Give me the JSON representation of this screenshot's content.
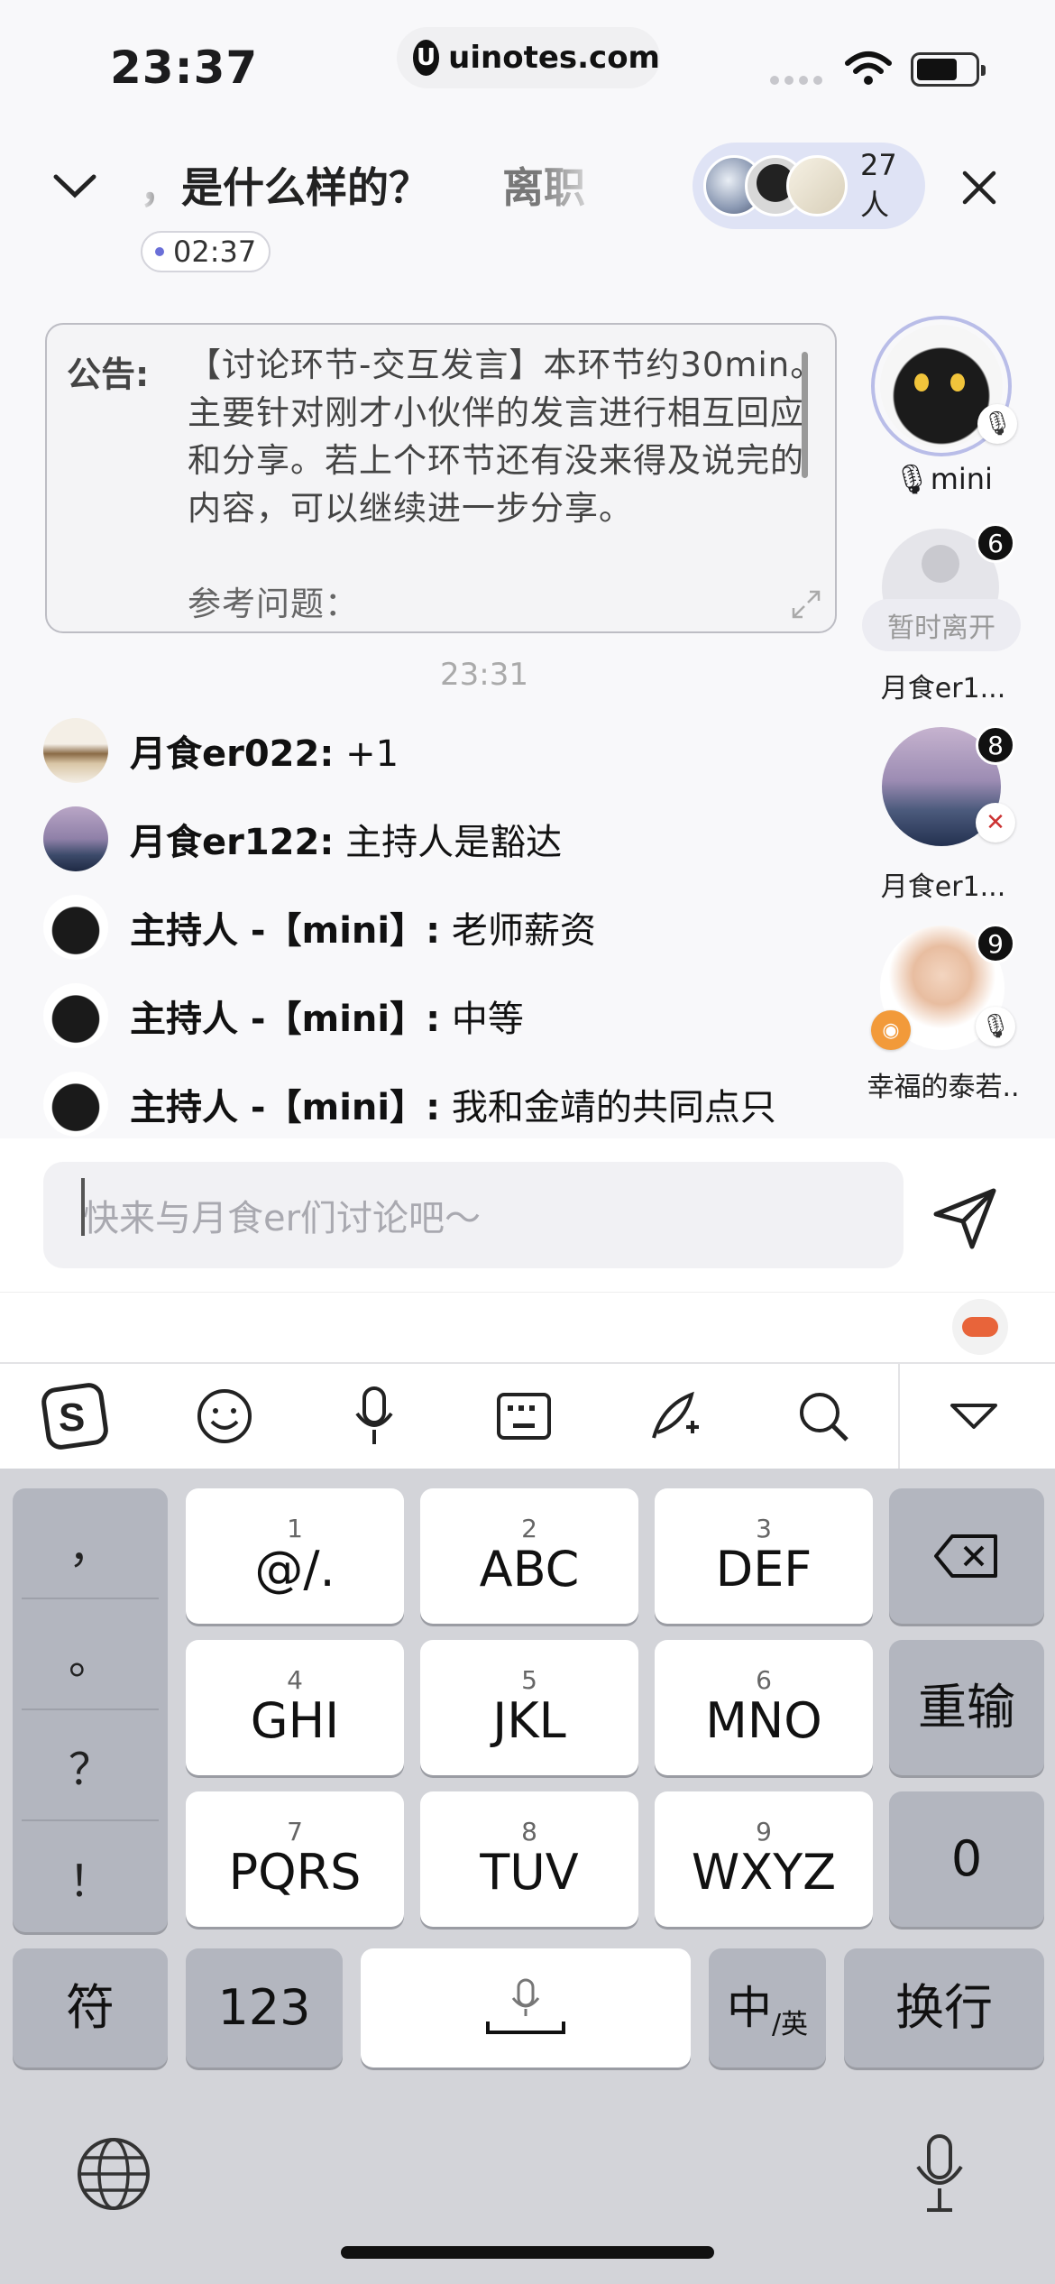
{
  "status_bar": {
    "time": "23:37",
    "url": "uinotes.com",
    "url_logo": "U"
  },
  "header": {
    "title_visible": "，是什么样的？",
    "title_next": "离职",
    "timer": "02:37",
    "member_count": "27人"
  },
  "notice": {
    "label": "公告:",
    "text": "【讨论环节-交互发言】本环节约30min。主要针对刚才小伙伴的发言进行相互回应和分享。若上个环节还有没来得及说完的内容，可以继续进一步分享。",
    "text_cut": "参考问题："
  },
  "chat": {
    "timestamp": "23:31",
    "messages": [
      {
        "name": "月食er022:",
        "text": " +1"
      },
      {
        "name": "月食er122:",
        "text": " 主持人是豁达"
      },
      {
        "name": "主持人 -【mini】:",
        "text": " 老师薪资"
      },
      {
        "name": "主持人 -【mini】:",
        "text": " 中等"
      },
      {
        "name": "主持人 -【mini】:",
        "text": " 我和金靖的共同点只"
      }
    ]
  },
  "members": [
    {
      "name": "mini",
      "badge": ""
    },
    {
      "name": "月食er1...",
      "badge": "6",
      "status": "暂时离开"
    },
    {
      "name": "月食er1...",
      "badge": "8"
    },
    {
      "name": "幸福的泰若..",
      "badge": "9"
    }
  ],
  "input": {
    "placeholder": "快来与月食er们讨论吧～"
  },
  "keyboard": {
    "punct": [
      "，",
      "。",
      "？",
      "！"
    ],
    "keys": [
      {
        "num": "1",
        "label": "@/."
      },
      {
        "num": "2",
        "label": "ABC"
      },
      {
        "num": "3",
        "label": "DEF"
      },
      {
        "num": "4",
        "label": "GHI"
      },
      {
        "num": "5",
        "label": "JKL"
      },
      {
        "num": "6",
        "label": "MNO"
      },
      {
        "num": "7",
        "label": "PQRS"
      },
      {
        "num": "8",
        "label": "TUV"
      },
      {
        "num": "9",
        "label": "WXYZ"
      }
    ],
    "retype": "重输",
    "zero": "0",
    "symbols": "符",
    "numbers": "123",
    "lang_main": "中",
    "lang_sub": "/英",
    "newline": "换行"
  },
  "colors": {
    "accent": "#6a6fd8",
    "pill_bg": "#dfe3f5",
    "kb_bg": "#d3d4d9"
  }
}
